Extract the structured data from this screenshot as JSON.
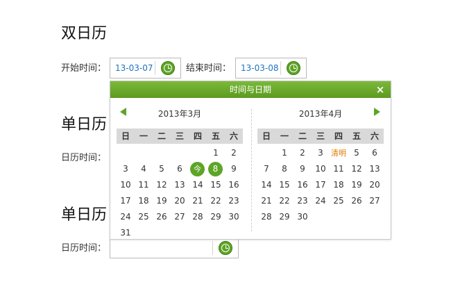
{
  "sections": {
    "dual": {
      "title": "双日历",
      "start_label": "开始时间：",
      "start_value": "13-03-07",
      "end_label": "结束时间：",
      "end_value": "13-03-08"
    },
    "single1": {
      "title": "单日历",
      "label": "日历时间："
    },
    "single2": {
      "title": "单日历",
      "label": "日历时间：",
      "value": ""
    }
  },
  "popup": {
    "title": "时间与日期",
    "close": "×",
    "weekdays": [
      "日",
      "一",
      "二",
      "三",
      "四",
      "五",
      "六"
    ],
    "months": [
      {
        "title": "2013年3月",
        "days": [
          "",
          "",
          "",
          "",
          "",
          "1",
          "2",
          "3",
          "4",
          "5",
          "6",
          "今天",
          "8",
          "9",
          "10",
          "11",
          "12",
          "13",
          "14",
          "15",
          "16",
          "17",
          "18",
          "19",
          "20",
          "21",
          "22",
          "23",
          "24",
          "25",
          "26",
          "27",
          "28",
          "29",
          "30",
          "31"
        ],
        "today_index": 11,
        "selected_index": 12
      },
      {
        "title": "2013年4月",
        "days": [
          "",
          "1",
          "2",
          "3",
          "清明",
          "5",
          "6",
          "7",
          "8",
          "9",
          "10",
          "11",
          "12",
          "13",
          "14",
          "15",
          "16",
          "17",
          "18",
          "19",
          "20",
          "21",
          "22",
          "23",
          "24",
          "25",
          "26",
          "27",
          "28",
          "29",
          "30"
        ],
        "holiday_index": 4
      }
    ]
  },
  "colors": {
    "accent": "#5ea427",
    "date_text": "#1e73be",
    "holiday": "#e07b00"
  }
}
